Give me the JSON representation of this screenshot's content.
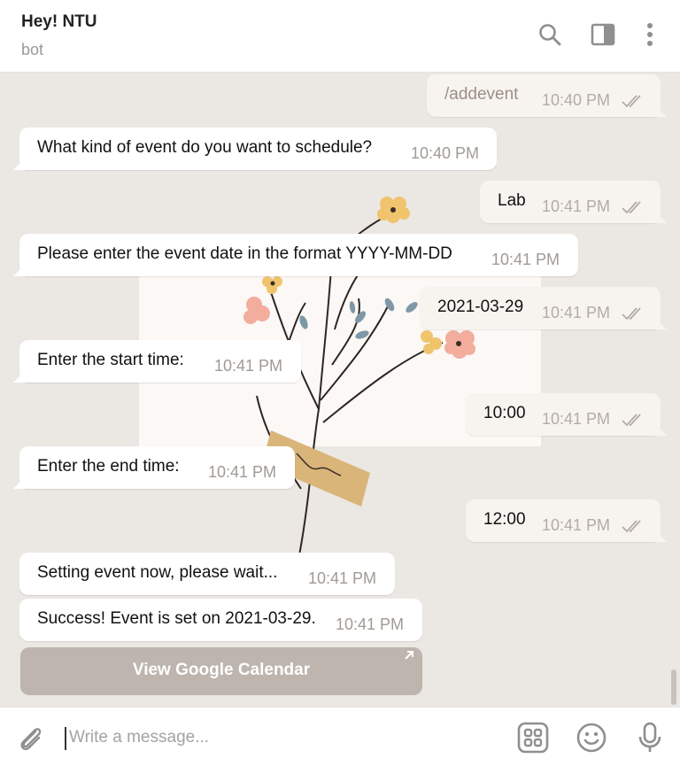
{
  "header": {
    "title": "Hey! NTU",
    "subtitle": "bot",
    "icons": [
      "search-icon",
      "sidebar-icon",
      "more-vertical-icon"
    ]
  },
  "messages": [
    {
      "direction": "out",
      "text": "/addevent",
      "time": "10:40 PM",
      "status": "read"
    },
    {
      "direction": "in",
      "text": "What kind of event do you want to schedule?",
      "time": "10:40 PM"
    },
    {
      "direction": "out",
      "text": "Lab",
      "time": "10:41 PM",
      "status": "read"
    },
    {
      "direction": "in",
      "text": "Please enter the event date in the format YYYY-MM-DD",
      "time": "10:41 PM"
    },
    {
      "direction": "out",
      "text": "2021-03-29",
      "time": "10:41 PM",
      "status": "read"
    },
    {
      "direction": "in",
      "text": "Enter the start time:",
      "time": "10:41 PM"
    },
    {
      "direction": "out",
      "text": "10:00",
      "time": "10:41 PM",
      "status": "read"
    },
    {
      "direction": "in",
      "text": "Enter the end time:",
      "time": "10:41 PM"
    },
    {
      "direction": "out",
      "text": "12:00",
      "time": "10:41 PM",
      "status": "read"
    },
    {
      "direction": "in",
      "text": "Setting event now, please wait...",
      "time": "10:41 PM"
    },
    {
      "direction": "in",
      "text": "Success! Event is set on 2021-03-29.",
      "time": "10:41 PM"
    }
  ],
  "inline_button": {
    "label": "View Google Calendar",
    "icon": "external-link-arrow-icon"
  },
  "composer": {
    "placeholder": "Write a message...",
    "value": "",
    "icons": [
      "paperclip-icon",
      "bot-commands-icon",
      "emoji-icon",
      "microphone-icon"
    ]
  },
  "colors": {
    "chat_background": "#ebe7e3",
    "incoming_bubble": "#ffffff",
    "outgoing_bubble": "#f7f4f0",
    "inline_button": "#bdb5ae",
    "icon_gray": "#8f8f8f"
  }
}
